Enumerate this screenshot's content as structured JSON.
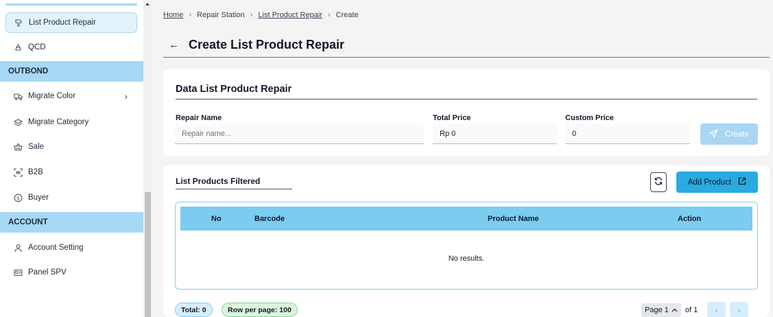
{
  "sidebar": {
    "items_top": [
      {
        "label": "List Product Repair",
        "icon": "repair-icon",
        "active": true
      },
      {
        "label": "QCD",
        "icon": "recycle-icon"
      }
    ],
    "section_outbound": "OUTBOND",
    "items_outbound": [
      {
        "label": "Migrate Color",
        "icon": "truck-icon",
        "has_chevron": true
      },
      {
        "label": "Migrate Category",
        "icon": "layers-icon"
      },
      {
        "label": "Sale",
        "icon": "basket-icon"
      },
      {
        "label": "B2B",
        "icon": "scan-icon"
      },
      {
        "label": "Buyer",
        "icon": "dollar-circle-icon"
      }
    ],
    "section_account": "ACCOUNT",
    "items_account": [
      {
        "label": "Account Setting",
        "icon": "user-icon"
      },
      {
        "label": "Panel SPV",
        "icon": "id-card-icon"
      }
    ],
    "chevron": "›"
  },
  "breadcrumb": {
    "home": "Home",
    "repair_station": "Repair Station",
    "list_product_repair": "List Product Repair",
    "current": "Create",
    "separator": "›"
  },
  "header": {
    "back_icon": "←",
    "title": "Create List Product Repair"
  },
  "form": {
    "title": "Data List Product Repair",
    "repair_name_label": "Repair Name",
    "repair_name_placeholder": "Repair name...",
    "repair_name_value": "",
    "total_price_label": "Total Price",
    "total_price_value": "Rp 0",
    "custom_price_label": "Custom Price",
    "custom_price_value": "0",
    "create_label": "Create",
    "create_icon": "send-icon",
    "create_color": "#a9d6f2"
  },
  "products": {
    "title": "List Products Filtered",
    "refresh_icon": "refresh-icon",
    "add_label": "Add Product",
    "add_icon": "external-link-icon",
    "add_color": "#29aae1",
    "columns": [
      "No",
      "Barcode",
      "Product Name",
      "Action"
    ],
    "empty_text": "No results.",
    "total_label": "Total: 0",
    "rows_label": "Row per page: 100",
    "page_label": "Page 1",
    "page_caret": "^",
    "of_label": "of 1",
    "prev_icon": "‹",
    "next_icon": "›",
    "header_color": "#7ccbf1"
  }
}
